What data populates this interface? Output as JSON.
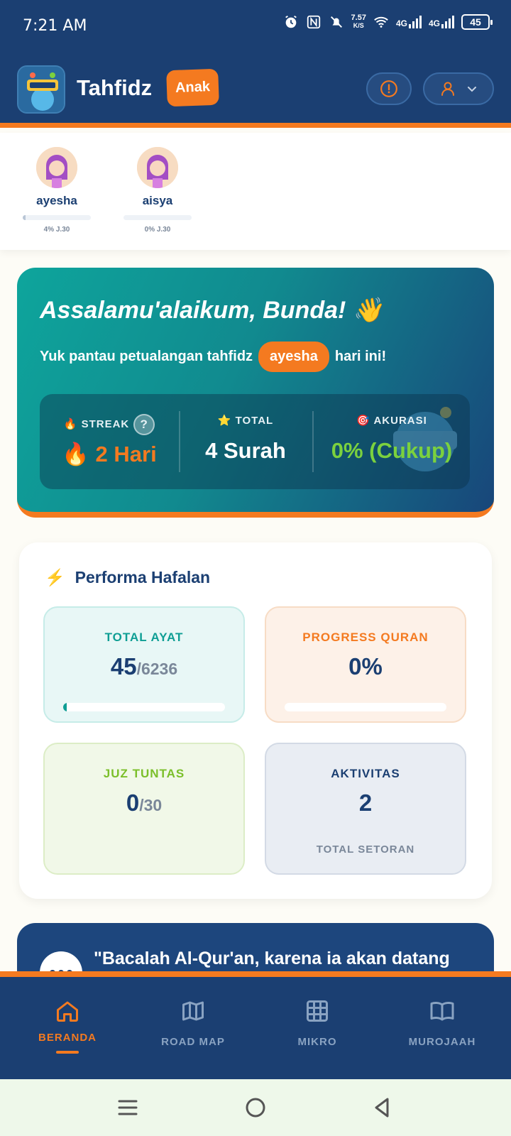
{
  "status_bar": {
    "time": "7:21 AM",
    "net_speed_value": "7.57",
    "net_speed_unit": "K/S",
    "net1": "4G",
    "net2": "4G",
    "battery": "45"
  },
  "header": {
    "title": "Tahfidz",
    "badge": "Anak",
    "logo_icon": "app-logo",
    "alert_icon": "alert-circle-icon",
    "user_icon": "user-icon"
  },
  "children": [
    {
      "name": "ayesha",
      "progress_label": "4% J.30",
      "progress": 0.04
    },
    {
      "name": "aisya",
      "progress_label": "0% J.30",
      "progress": 0.0
    }
  ],
  "hero": {
    "greeting": "Assalamu'alaikum, Bunda! 👋",
    "sub_prefix": "Yuk pantau petualangan tahfidz",
    "active_child": "ayesha",
    "sub_suffix": "hari ini!",
    "stats": [
      {
        "label": "🔥 STREAK",
        "value": "🔥 2 Hari",
        "color": "#f47a20",
        "help": "?"
      },
      {
        "label": "⭐ TOTAL",
        "value": "4 Surah",
        "color": "#ffffff"
      },
      {
        "label": "🎯 AKURASI",
        "value": "0% (Cukup)",
        "color": "#7bd13e"
      }
    ]
  },
  "performance": {
    "title": "Performa Hafalan",
    "icon": "⚡",
    "tiles": [
      {
        "label": "TOTAL AYAT",
        "value": "45",
        "suffix": "/6236",
        "progress": 0.007,
        "label_color": "#0e9e94"
      },
      {
        "label": "PROGRESS QURAN",
        "value": "0%",
        "suffix": "",
        "progress": 0.0,
        "label_color": "#f47a20"
      },
      {
        "label": "JUZ TUNTAS",
        "value": "0",
        "suffix": "/30",
        "label_color": "#7bbf2a"
      },
      {
        "label": "AKTIVITAS",
        "value": "2",
        "suffix": "",
        "footer": "TOTAL SETORAN",
        "label_color": "#1b3f72"
      }
    ]
  },
  "quote": {
    "text": "\"Bacalah Al-Qur'an, karena ia akan datang"
  },
  "bottom_nav": [
    {
      "label": "BERANDA",
      "icon": "home-icon",
      "active": true
    },
    {
      "label": "ROAD MAP",
      "icon": "map-icon",
      "active": false
    },
    {
      "label": "MIKRO",
      "icon": "grid-icon",
      "active": false
    },
    {
      "label": "MUROJAAH",
      "icon": "book-icon",
      "active": false
    }
  ],
  "colors": {
    "primary": "#1b3f72",
    "accent": "#f47a20",
    "teal": "#0e9e94"
  }
}
